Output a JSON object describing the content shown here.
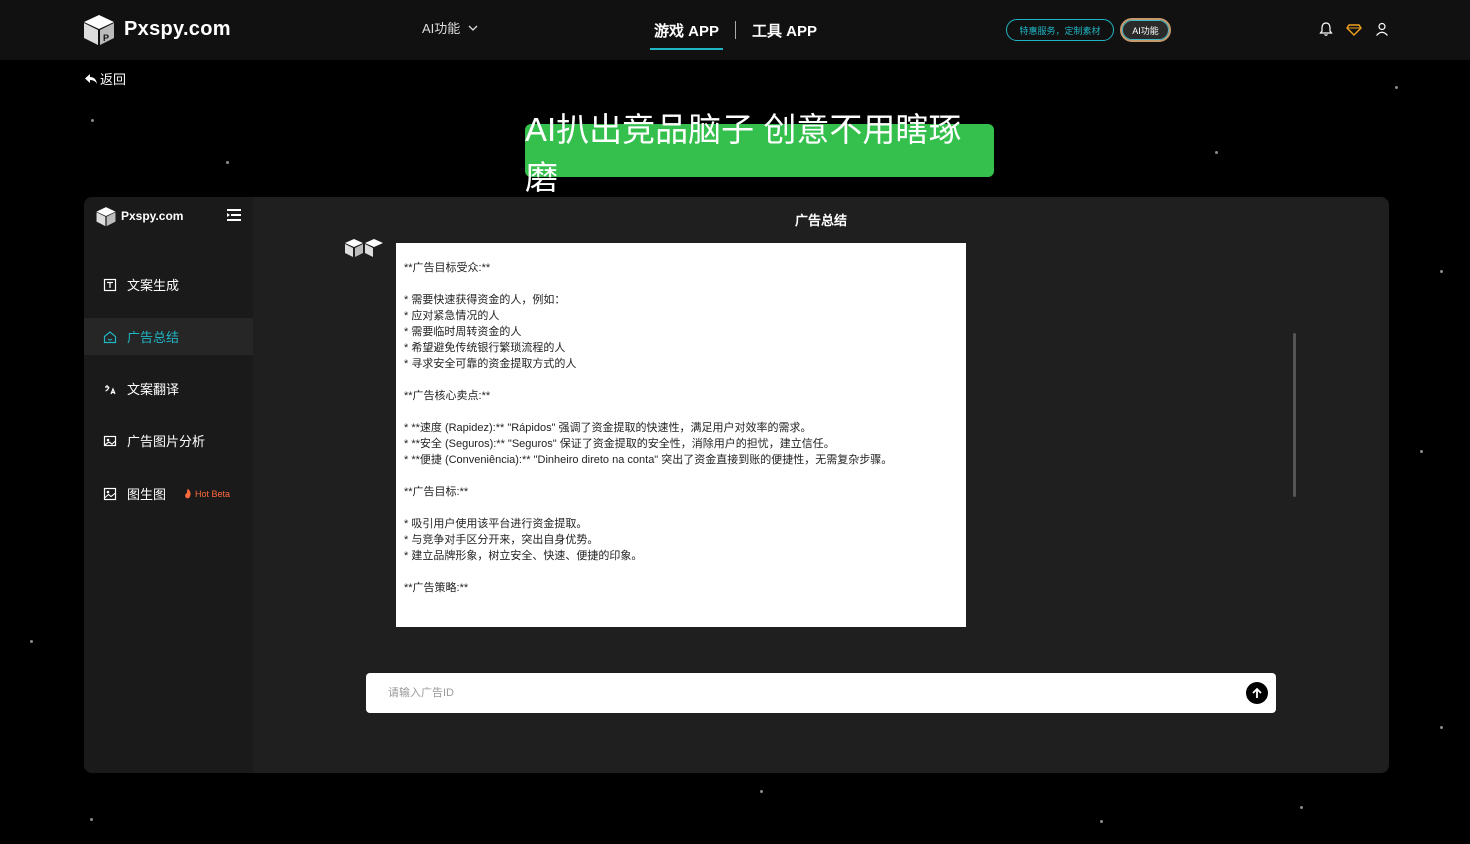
{
  "header": {
    "logo_text": "Pxspy.com",
    "ai_menu_label": "AI功能",
    "app_tabs": [
      {
        "label": "游戏 APP",
        "active": true
      },
      {
        "label": "工具 APP",
        "active": false
      }
    ],
    "promo_pill": "特惠服务，定制素材",
    "ai_pill": "AI功能",
    "icons": [
      "bell-icon",
      "diamond-icon",
      "user-icon"
    ]
  },
  "back_label": "返回",
  "banner_text": "AI扒出竞品脑子 创意不用瞎琢磨",
  "sidebar": {
    "logo_text": "Pxspy.com",
    "items": [
      {
        "label": "文案生成",
        "icon": "document-icon",
        "active": false
      },
      {
        "label": "广告总结",
        "icon": "home-icon",
        "active": true
      },
      {
        "label": "文案翻译",
        "icon": "translate-icon",
        "active": false
      },
      {
        "label": "广告图片分析",
        "icon": "image-analysis-icon",
        "active": false
      },
      {
        "label": "图生图",
        "icon": "image-icon",
        "active": false,
        "badge": "Hot Beta"
      }
    ]
  },
  "content": {
    "title": "广告总结",
    "message_text": "**广告目标受众:**\n\n* 需要快速获得资金的人，例如：\n* 应对紧急情况的人\n* 需要临时周转资金的人\n* 希望避免传统银行繁琐流程的人\n* 寻求安全可靠的资金提取方式的人\n\n**广告核心卖点:**\n\n* **速度 (Rapidez):** \"Rápidos\" 强调了资金提取的快速性，满足用户对效率的需求。\n* **安全 (Seguros):** \"Seguros\" 保证了资金提取的安全性，消除用户的担忧，建立信任。\n* **便捷 (Conveniência):** \"Dinheiro direto na conta\" 突出了资金直接到账的便捷性，无需复杂步骤。\n\n**广告目标:**\n\n* 吸引用户使用该平台进行资金提取。\n* 与竞争对手区分开来，突出自身优势。\n* 建立品牌形象，树立安全、快速、便捷的印象。\n\n**广告策略:**",
    "input_placeholder": "请输入广告ID"
  },
  "colors": {
    "accent": "#1fb5c4",
    "banner": "#35c04e",
    "hot": "#ff6a3d"
  }
}
